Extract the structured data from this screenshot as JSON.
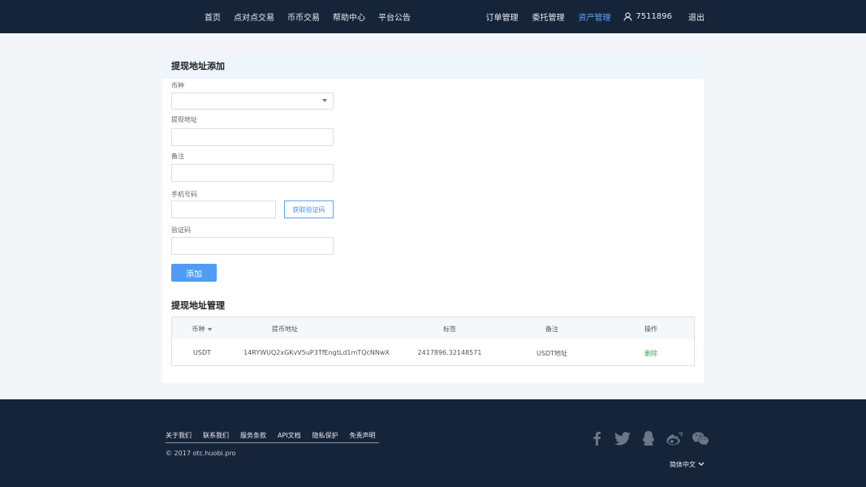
{
  "nav": {
    "left": [
      "首页",
      "点对点交易",
      "币币交易",
      "帮助中心",
      "平台公告"
    ],
    "right": [
      "订单管理",
      "委托管理",
      "资产管理"
    ],
    "active": "资产管理",
    "username": "7511896",
    "logout": "退出",
    "colors": {
      "bg": "#16243a",
      "active": "#5aa6ff"
    }
  },
  "form": {
    "title": "提现地址添加",
    "currency_label": "币种",
    "currency_value": "",
    "address_label": "提现地址",
    "address_value": "",
    "remark_label": "备注",
    "remark_value": "",
    "phone_label": "手机号码",
    "phone_value": "",
    "get_code_button": "获取验证码",
    "code_label": "验证码",
    "code_value": "",
    "add_button": "添加"
  },
  "manage": {
    "title": "提现地址管理",
    "headers": [
      "币种",
      "提币地址",
      "标签",
      "备注",
      "操作"
    ],
    "rows": [
      {
        "currency": "USDT",
        "address": "14RYWUQ2xGKvV5uP3TfEngtLd1mTQcNNwX",
        "tag": "2417896.32148571",
        "remark": "USDT地址",
        "action": "删除"
      }
    ]
  },
  "footer": {
    "links": [
      "关于我们",
      "联系我们",
      "服务条款",
      "API文档",
      "隐私保护",
      "免责声明"
    ],
    "copyright": "© 2017 otc.huobi.pro",
    "socials": [
      "facebook-icon",
      "twitter-icon",
      "qq-icon",
      "weibo-icon",
      "wechat-icon"
    ],
    "language": "简体中文"
  }
}
